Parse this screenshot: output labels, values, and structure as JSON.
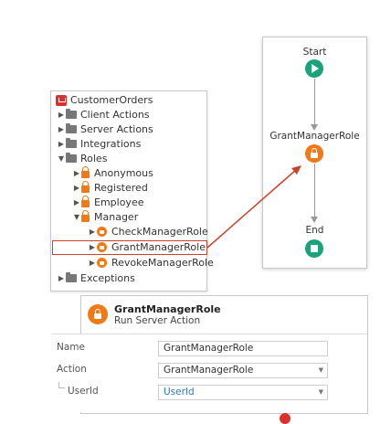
{
  "tree": {
    "root": "CustomerOrders",
    "items": [
      {
        "label": "Client Actions"
      },
      {
        "label": "Server Actions"
      },
      {
        "label": "Integrations"
      },
      {
        "label": "Roles"
      },
      {
        "label": "Anonymous"
      },
      {
        "label": "Registered"
      },
      {
        "label": "Employee"
      },
      {
        "label": "Manager"
      },
      {
        "label": "CheckManagerRole"
      },
      {
        "label": "GrantManagerRole"
      },
      {
        "label": "RevokeManagerRole"
      },
      {
        "label": "Exceptions"
      }
    ]
  },
  "flow": {
    "start_label": "Start",
    "action_label": "GrantManagerRole",
    "end_label": "End"
  },
  "properties": {
    "title": "GrantManagerRole",
    "subtitle": "Run Server Action",
    "rows": [
      {
        "label": "Name",
        "value": "GrantManagerRole"
      },
      {
        "label": "Action",
        "value": "GrantManagerRole"
      },
      {
        "label": "UserId",
        "value": "UserId"
      }
    ]
  },
  "colors": {
    "accent_orange": "#ef7a17",
    "flow_green": "#1aa37a",
    "highlight_red": "#c9432c",
    "brand_red": "#d9312f"
  }
}
